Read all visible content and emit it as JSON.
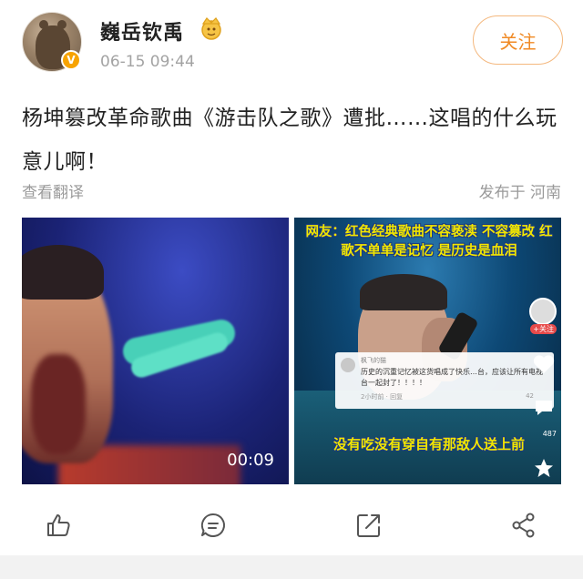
{
  "user": {
    "name": "巍岳钦禹",
    "timestamp": "06-15 09:44",
    "verified_badge": "V",
    "follow_label": "关注"
  },
  "post": {
    "text": "杨坤篡改革命歌曲《游击队之歌》遭批……这唱的什么玩意儿啊！",
    "translate_label": "查看翻译",
    "location": "发布于 河南"
  },
  "media": {
    "video_duration": "00:09",
    "right_overlay_top": "网友：红色经典歌曲不容亵渎 不容篡改 红歌不单单是记忆 是历史是血泪",
    "right_overlay_bottom": "没有吃没有穿自有那敌人送上前",
    "comment": {
      "name": "枫飞的猫",
      "text": "历史的沉重记忆被这货唱成了快乐…台，应该让所有电视台一起封了！！！！",
      "meta": "2小时前 · 回复",
      "likes": "42"
    },
    "side_follow": "+关注",
    "side_count": "487"
  },
  "colors": {
    "accent": "#f08a25",
    "follow_border": "#f4b87e",
    "muted_text": "#9a9a9a",
    "overlay_text": "#f2e600"
  },
  "actions": {
    "icons": [
      "like-icon",
      "comment-icon",
      "repost-icon",
      "share-icon"
    ]
  }
}
